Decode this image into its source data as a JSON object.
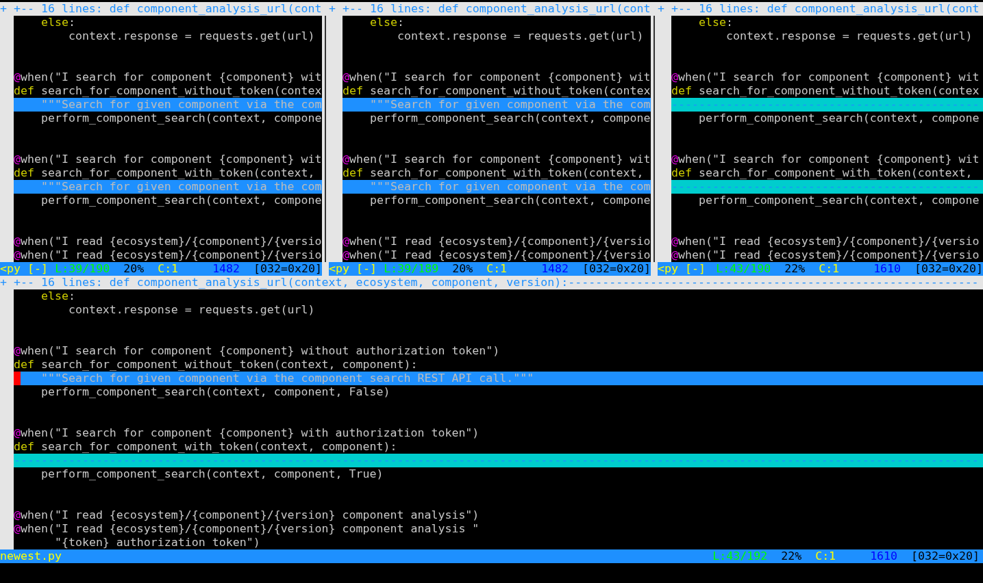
{
  "top_windows": [
    {
      "fold": "+ +-- 16 lines: def component_analysis_url(cont",
      "lines": [
        {
          "kind": "code",
          "segments": [
            {
              "kind": "kw",
              "text": "    else"
            },
            {
              "kind": "text",
              "text": ":"
            }
          ]
        },
        {
          "kind": "code",
          "segments": [
            {
              "kind": "text",
              "text": "        context.response = requests.get(url)"
            }
          ]
        },
        {
          "kind": "blank"
        },
        {
          "kind": "blank"
        },
        {
          "kind": "code",
          "segments": [
            {
              "kind": "deco",
              "text": "@"
            },
            {
              "kind": "text",
              "text": "when(\"I search for component {component} wit"
            }
          ]
        },
        {
          "kind": "code",
          "segments": [
            {
              "kind": "kw",
              "text": "def"
            },
            {
              "kind": "text",
              "text": " search_for_component_without_token(contex"
            }
          ]
        },
        {
          "kind": "changed",
          "segments": [
            {
              "kind": "doc",
              "text": "    \"\"\"Search for given component via the com"
            }
          ]
        },
        {
          "kind": "code",
          "segments": [
            {
              "kind": "text",
              "text": "    perform_component_search(context, compone"
            }
          ]
        },
        {
          "kind": "blank"
        },
        {
          "kind": "blank"
        },
        {
          "kind": "code",
          "segments": [
            {
              "kind": "deco",
              "text": "@"
            },
            {
              "kind": "text",
              "text": "when(\"I search for component {component} wit"
            }
          ]
        },
        {
          "kind": "code",
          "segments": [
            {
              "kind": "kw",
              "text": "def"
            },
            {
              "kind": "text",
              "text": " search_for_component_with_token(context, "
            }
          ]
        },
        {
          "kind": "changed",
          "segments": [
            {
              "kind": "doc",
              "text": "    \"\"\"Search for given component via the com"
            }
          ]
        },
        {
          "kind": "code",
          "segments": [
            {
              "kind": "text",
              "text": "    perform_component_search(context, compone"
            }
          ]
        },
        {
          "kind": "blank"
        },
        {
          "kind": "blank"
        },
        {
          "kind": "code",
          "segments": [
            {
              "kind": "deco",
              "text": "@"
            },
            {
              "kind": "text",
              "text": "when(\"I read {ecosystem}/{component}/{versio"
            }
          ]
        },
        {
          "kind": "code",
          "segments": [
            {
              "kind": "deco",
              "text": "@"
            },
            {
              "kind": "text",
              "text": "when(\"I read {ecosystem}/{component}/{versio"
            }
          ]
        }
      ],
      "status": [
        {
          "kind": "filetype",
          "text": "<py"
        },
        {
          "kind": "flag",
          "text": "[-]"
        },
        {
          "kind": "line",
          "text": "L:39/190"
        },
        {
          "kind": "pct",
          "text": "20%"
        },
        {
          "kind": "col",
          "text": "C:1"
        },
        {
          "kind": "bytes",
          "text": "1482"
        },
        {
          "kind": "char",
          "text": "[032=0x20]"
        }
      ]
    },
    {
      "fold": "+ +-- 16 lines: def component_analysis_url(cont",
      "lines": [
        {
          "kind": "code",
          "segments": [
            {
              "kind": "kw",
              "text": "    else"
            },
            {
              "kind": "text",
              "text": ":"
            }
          ]
        },
        {
          "kind": "code",
          "segments": [
            {
              "kind": "text",
              "text": "        context.response = requests.get(url)"
            }
          ]
        },
        {
          "kind": "blank"
        },
        {
          "kind": "blank"
        },
        {
          "kind": "code",
          "segments": [
            {
              "kind": "deco",
              "text": "@"
            },
            {
              "kind": "text",
              "text": "when(\"I search for component {component} wit"
            }
          ]
        },
        {
          "kind": "code",
          "segments": [
            {
              "kind": "kw",
              "text": "def"
            },
            {
              "kind": "text",
              "text": " search_for_component_without_token(contex"
            }
          ]
        },
        {
          "kind": "changed",
          "segments": [
            {
              "kind": "doc",
              "text": "    \"\"\"Search for given component via the com"
            }
          ]
        },
        {
          "kind": "code",
          "segments": [
            {
              "kind": "text",
              "text": "    perform_component_search(context, compone"
            }
          ]
        },
        {
          "kind": "blank"
        },
        {
          "kind": "blank"
        },
        {
          "kind": "code",
          "segments": [
            {
              "kind": "deco",
              "text": "@"
            },
            {
              "kind": "text",
              "text": "when(\"I search for component {component} wit"
            }
          ]
        },
        {
          "kind": "code",
          "segments": [
            {
              "kind": "kw",
              "text": "def"
            },
            {
              "kind": "text",
              "text": " search_for_component_with_token(context, "
            }
          ]
        },
        {
          "kind": "changed",
          "segments": [
            {
              "kind": "doc",
              "text": "    \"\"\"Search for given component via the com"
            }
          ]
        },
        {
          "kind": "code",
          "segments": [
            {
              "kind": "text",
              "text": "    perform_component_search(context, compone"
            }
          ]
        },
        {
          "kind": "blank"
        },
        {
          "kind": "blank"
        },
        {
          "kind": "code",
          "segments": [
            {
              "kind": "deco",
              "text": "@"
            },
            {
              "kind": "text",
              "text": "when(\"I read {ecosystem}/{component}/{versio"
            }
          ]
        },
        {
          "kind": "code",
          "segments": [
            {
              "kind": "deco",
              "text": "@"
            },
            {
              "kind": "text",
              "text": "when(\"I read {ecosystem}/{component}/{versio"
            }
          ]
        }
      ],
      "status": [
        {
          "kind": "filetype",
          "text": "<py"
        },
        {
          "kind": "flag",
          "text": "[-]"
        },
        {
          "kind": "line",
          "text": "L:39/189"
        },
        {
          "kind": "pct",
          "text": "20%"
        },
        {
          "kind": "col",
          "text": "C:1"
        },
        {
          "kind": "bytes",
          "text": "1482"
        },
        {
          "kind": "char",
          "text": "[032=0x20]"
        }
      ]
    },
    {
      "fold": "+ +-- 16 lines: def component_analysis_url(cont",
      "lines": [
        {
          "kind": "code",
          "segments": [
            {
              "kind": "kw",
              "text": "    else"
            },
            {
              "kind": "text",
              "text": ":"
            }
          ]
        },
        {
          "kind": "code",
          "segments": [
            {
              "kind": "text",
              "text": "        context.response = requests.get(url)"
            }
          ]
        },
        {
          "kind": "blank"
        },
        {
          "kind": "blank"
        },
        {
          "kind": "code",
          "segments": [
            {
              "kind": "deco",
              "text": "@"
            },
            {
              "kind": "text",
              "text": "when(\"I search for component {component} wit"
            }
          ]
        },
        {
          "kind": "code",
          "segments": [
            {
              "kind": "kw",
              "text": "def"
            },
            {
              "kind": "text",
              "text": " search_for_component_without_token(contex"
            }
          ]
        },
        {
          "kind": "filler",
          "segments": [
            {
              "kind": "dash",
              "text": "---------------------------------------------"
            }
          ]
        },
        {
          "kind": "code",
          "segments": [
            {
              "kind": "text",
              "text": "    perform_component_search(context, compone"
            }
          ]
        },
        {
          "kind": "blank"
        },
        {
          "kind": "blank"
        },
        {
          "kind": "code",
          "segments": [
            {
              "kind": "deco",
              "text": "@"
            },
            {
              "kind": "text",
              "text": "when(\"I search for component {component} wit"
            }
          ]
        },
        {
          "kind": "code",
          "segments": [
            {
              "kind": "kw",
              "text": "def"
            },
            {
              "kind": "text",
              "text": " search_for_component_with_token(context, "
            }
          ]
        },
        {
          "kind": "filler",
          "segments": [
            {
              "kind": "dash",
              "text": "---------------------------------------------"
            }
          ]
        },
        {
          "kind": "code",
          "segments": [
            {
              "kind": "text",
              "text": "    perform_component_search(context, compone"
            }
          ]
        },
        {
          "kind": "blank"
        },
        {
          "kind": "blank"
        },
        {
          "kind": "code",
          "segments": [
            {
              "kind": "deco",
              "text": "@"
            },
            {
              "kind": "text",
              "text": "when(\"I read {ecosystem}/{component}/{versio"
            }
          ]
        },
        {
          "kind": "code",
          "segments": [
            {
              "kind": "deco",
              "text": "@"
            },
            {
              "kind": "text",
              "text": "when(\"I read {ecosystem}/{component}/{versio"
            }
          ]
        }
      ],
      "status": [
        {
          "kind": "filetype",
          "text": "<py"
        },
        {
          "kind": "flag",
          "text": "[-]"
        },
        {
          "kind": "line",
          "text": "L:43/190"
        },
        {
          "kind": "pct",
          "text": "22%"
        },
        {
          "kind": "col",
          "text": "C:1"
        },
        {
          "kind": "bytes",
          "text": "1610"
        },
        {
          "kind": "char",
          "text": "[032=0x20]"
        }
      ]
    }
  ],
  "bottom_window": {
    "fold": "+ +-- 16 lines: def component_analysis_url(context, ecosystem, component, version):------------------------------------------------------------",
    "lines": [
      {
        "kind": "code",
        "segments": [
          {
            "kind": "kw",
            "text": "    else"
          },
          {
            "kind": "text",
            "text": ":"
          }
        ]
      },
      {
        "kind": "code",
        "segments": [
          {
            "kind": "text",
            "text": "        context.response = requests.get(url)"
          }
        ]
      },
      {
        "kind": "blank"
      },
      {
        "kind": "blank"
      },
      {
        "kind": "code",
        "segments": [
          {
            "kind": "deco",
            "text": "@"
          },
          {
            "kind": "text",
            "text": "when(\"I search for component {component} without authorization token\")"
          }
        ]
      },
      {
        "kind": "code",
        "segments": [
          {
            "kind": "kw",
            "text": "def"
          },
          {
            "kind": "text",
            "text": " search_for_component_without_token(context, component):"
          }
        ]
      },
      {
        "kind": "changed",
        "cursor": true,
        "segments": [
          {
            "kind": "doc",
            "text": "    \"\"\"Search for given component via the component search REST API call.\"\"\""
          }
        ]
      },
      {
        "kind": "code",
        "segments": [
          {
            "kind": "text",
            "text": "    perform_component_search(context, component, False)"
          }
        ]
      },
      {
        "kind": "blank"
      },
      {
        "kind": "blank"
      },
      {
        "kind": "code",
        "segments": [
          {
            "kind": "deco",
            "text": "@"
          },
          {
            "kind": "text",
            "text": "when(\"I search for component {component} with authorization token\")"
          }
        ]
      },
      {
        "kind": "code",
        "segments": [
          {
            "kind": "kw",
            "text": "def"
          },
          {
            "kind": "text",
            "text": " search_for_component_with_token(context, component):"
          }
        ]
      },
      {
        "kind": "filler",
        "segments": [
          {
            "kind": "dash",
            "text": "---------------------------------------------------------------------------------------------------------------------------------------------"
          }
        ]
      },
      {
        "kind": "code",
        "segments": [
          {
            "kind": "text",
            "text": "    perform_component_search(context, component, True)"
          }
        ]
      },
      {
        "kind": "blank"
      },
      {
        "kind": "blank"
      },
      {
        "kind": "code",
        "segments": [
          {
            "kind": "deco",
            "text": "@"
          },
          {
            "kind": "text",
            "text": "when(\"I read {ecosystem}/{component}/{version} component analysis\")"
          }
        ]
      },
      {
        "kind": "code",
        "segments": [
          {
            "kind": "deco",
            "text": "@"
          },
          {
            "kind": "text",
            "text": "when(\"I read {ecosystem}/{component}/{version} component analysis \""
          }
        ]
      },
      {
        "kind": "code",
        "segments": [
          {
            "kind": "text",
            "text": "      \"{token} authorization token\")"
          }
        ]
      }
    ],
    "status": [
      {
        "kind": "file",
        "text": "newest.py"
      },
      {
        "kind": "line",
        "text": "L:43/192"
      },
      {
        "kind": "pct",
        "text": "22%"
      },
      {
        "kind": "col",
        "text": "C:1"
      },
      {
        "kind": "bytes",
        "text": "1610"
      },
      {
        "kind": "char",
        "text": "[032=0x20]"
      }
    ]
  }
}
